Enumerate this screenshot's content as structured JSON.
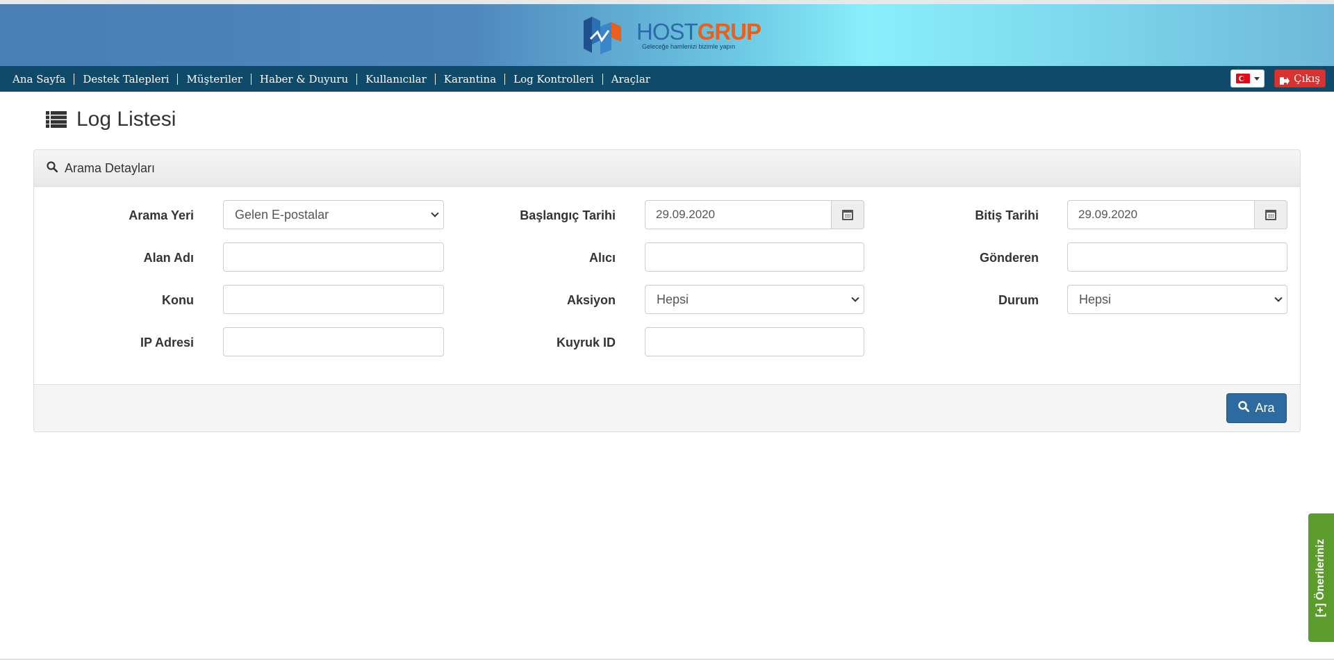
{
  "header": {
    "logo": {
      "host": "HOST",
      "grup": "GRUP",
      "tagline": "Geleceğe hamlenizi bizimle yapın"
    }
  },
  "nav": {
    "items": [
      "Ana Sayfa",
      "Destek Talepleri",
      "Müşteriler",
      "Haber & Duyuru",
      "Kullanıcılar",
      "Karantina",
      "Log Kontrolleri",
      "Araçlar"
    ],
    "logout_label": "Çıkış",
    "language_flag": "turkey-flag-icon"
  },
  "page": {
    "title": "Log Listesi"
  },
  "panel": {
    "heading": "Arama Detayları",
    "labels": {
      "arama_yeri": "Arama Yeri",
      "baslangic_tarihi": "Başlangıç Tarihi",
      "bitis_tarihi": "Bitiş Tarihi",
      "alan_adi": "Alan Adı",
      "alici": "Alıcı",
      "gonderen": "Gönderen",
      "konu": "Konu",
      "aksiyon": "Aksiyon",
      "durum": "Durum",
      "ip_adresi": "IP Adresi",
      "kuyruk_id": "Kuyruk ID"
    },
    "values": {
      "arama_yeri": "Gelen E-postalar",
      "baslangic_tarihi": "29.09.2020",
      "bitis_tarihi": "29.09.2020",
      "aksiyon": "Hepsi",
      "durum": "Hepsi"
    },
    "search_button": "Ara"
  },
  "feedback": {
    "label": "[+] Önerileriniz"
  },
  "colors": {
    "navbar": "#0f4a6a",
    "primary_button": "#2c6aa0",
    "danger_button": "#d9332f",
    "feedback_tab": "#5c9c2d"
  }
}
